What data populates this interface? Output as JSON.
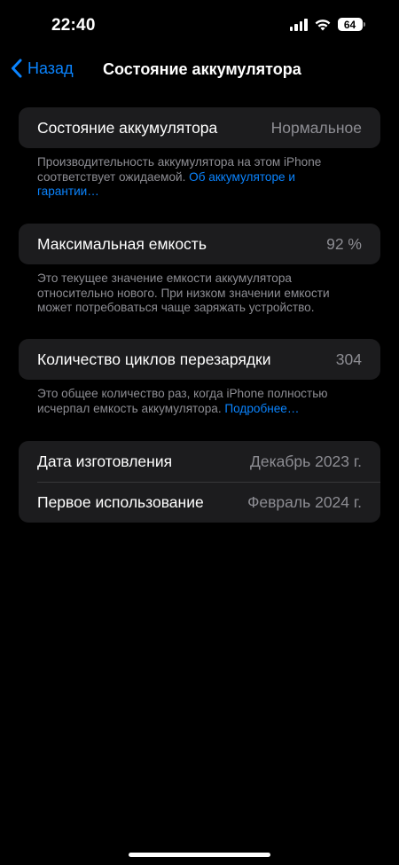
{
  "status_bar": {
    "time": "22:40",
    "battery_level": "64",
    "icons": [
      "signal-bars-icon",
      "wifi-icon",
      "battery-icon"
    ]
  },
  "nav": {
    "back_label": "Назад",
    "title": "Состояние аккумулятора"
  },
  "battery_state": {
    "label": "Состояние аккумулятора",
    "value": "Нормальное",
    "note_text": "Производительность аккумулятора на этом iPhone соответствует ожидаемой. ",
    "note_link": "Об аккумуляторе и гарантии…"
  },
  "capacity": {
    "label": "Максимальная емкость",
    "value": "92 %",
    "note_text": "Это текущее значение емкости аккумулятора относительно нового. При низком значении емкости может потребоваться чаще заряжать устройство."
  },
  "cycles": {
    "label": "Количество циклов перезарядки",
    "value": "304",
    "note_text": "Это общее количество раз, когда iPhone полностью исчерпал емкость аккумулятора. ",
    "note_link": "Подробнее…"
  },
  "dates": {
    "manufacture_label": "Дата изготовления",
    "manufacture_value": "Декабрь 2023 г.",
    "first_use_label": "Первое использование",
    "first_use_value": "Февраль 2024 г."
  },
  "colors": {
    "background": "#000000",
    "cell": "#1c1c1e",
    "accent": "#0a84ff",
    "secondary_text": "#8d8d93"
  }
}
